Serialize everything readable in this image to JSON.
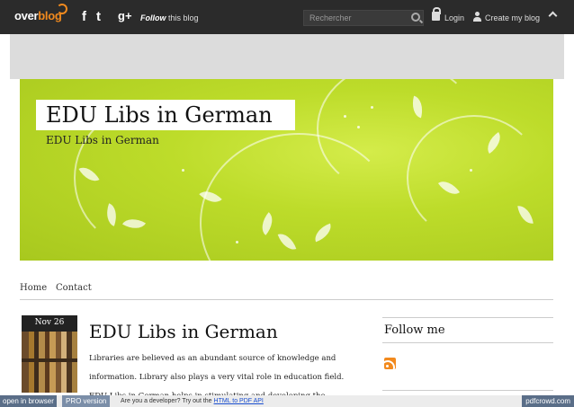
{
  "topbar": {
    "logo_over": "over",
    "logo_blog": "blog",
    "social": [
      "f",
      "t",
      "g+"
    ],
    "follow_bold": "Follow",
    "follow_rest": " this blog",
    "search_placeholder": "Rechercher",
    "login": "Login",
    "create": "Create my blog"
  },
  "banner": {
    "title": "EDU Libs in German",
    "subtitle": "EDU Libs in German"
  },
  "nav": {
    "items": [
      {
        "label": "Home"
      },
      {
        "label": "Contact"
      }
    ]
  },
  "post": {
    "date": "Nov 26",
    "title": "EDU Libs in German",
    "lines": [
      "Libraries are believed as an abundant source of knowledge and",
      "information. Library also plays a very vital role in education field.",
      "EDU Libs in German helps in stimulating and developing the"
    ]
  },
  "sidebar": {
    "title": "Follow me"
  },
  "pdfcrowd": {
    "open": "open in browser",
    "pro": "PRO version",
    "msg": "Are you a developer? Try out the ",
    "link": "HTML to PDF API",
    "brand": "pdfcrowd.com"
  },
  "colors": {
    "topbar": "#2b2b2b",
    "accent": "#f28a1e",
    "banner_green": "#bddc2a"
  }
}
